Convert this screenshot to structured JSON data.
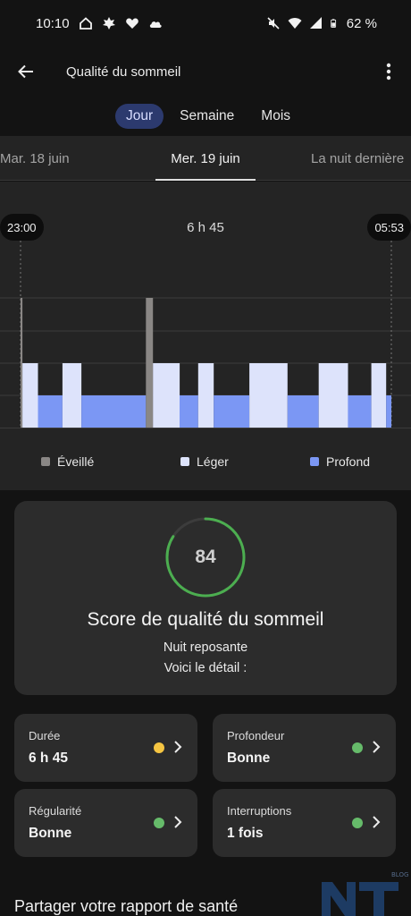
{
  "status_bar": {
    "time": "10:10",
    "left_icons": [
      "home-icon",
      "leaf-icon",
      "heart-icon",
      "cloud-icon"
    ],
    "right_icons": [
      "mute-icon",
      "wifi-icon",
      "signal-icon",
      "battery-icon"
    ],
    "battery": "62 %"
  },
  "app_bar": {
    "title": "Qualité du sommeil"
  },
  "period_tabs": [
    {
      "label": "Jour",
      "active": true
    },
    {
      "label": "Semaine",
      "active": false
    },
    {
      "label": "Mois",
      "active": false
    }
  ],
  "dates": {
    "prev": "Mar. 18 juin",
    "current": "Mer. 19 juin",
    "next": "La nuit dernière"
  },
  "chart_data": {
    "type": "hypnogram",
    "start_time": "23:00",
    "end_time": "05:53",
    "duration": "6 h 45",
    "legend": [
      {
        "label": "Éveillé",
        "color": "#8a8785"
      },
      {
        "label": "Léger",
        "color": "#dde3fb"
      },
      {
        "label": "Profond",
        "color": "#7b97f4"
      }
    ],
    "stages": [
      {
        "stage": "Éveillé",
        "start": 0.0,
        "end": 0.005
      },
      {
        "stage": "Léger",
        "start": 0.005,
        "end": 0.047
      },
      {
        "stage": "Profond",
        "start": 0.047,
        "end": 0.113
      },
      {
        "stage": "Léger",
        "start": 0.113,
        "end": 0.164
      },
      {
        "stage": "Profond",
        "start": 0.164,
        "end": 0.338
      },
      {
        "stage": "Éveillé",
        "start": 0.338,
        "end": 0.357
      },
      {
        "stage": "Léger",
        "start": 0.357,
        "end": 0.429
      },
      {
        "stage": "Profond",
        "start": 0.429,
        "end": 0.479
      },
      {
        "stage": "Léger",
        "start": 0.479,
        "end": 0.521
      },
      {
        "stage": "Profond",
        "start": 0.521,
        "end": 0.617
      },
      {
        "stage": "Léger",
        "start": 0.617,
        "end": 0.72
      },
      {
        "stage": "Profond",
        "start": 0.72,
        "end": 0.804
      },
      {
        "stage": "Léger",
        "start": 0.804,
        "end": 0.883
      },
      {
        "stage": "Profond",
        "start": 0.883,
        "end": 0.946
      },
      {
        "stage": "Léger",
        "start": 0.946,
        "end": 0.986
      },
      {
        "stage": "Profond",
        "start": 0.986,
        "end": 1.0
      }
    ]
  },
  "score": {
    "value": "84",
    "fraction": 0.84,
    "ring_color": "#4cae50",
    "title": "Score de qualité du sommeil",
    "subtitle": "Nuit reposante",
    "detail": "Voici le détail :"
  },
  "metrics": [
    {
      "label": "Durée",
      "value": "6 h 45",
      "status_color": "#f5c542"
    },
    {
      "label": "Profondeur",
      "value": "Bonne",
      "status_color": "#66bb6a"
    },
    {
      "label": "Régularité",
      "value": "Bonne",
      "status_color": "#66bb6a"
    },
    {
      "label": "Interruptions",
      "value": "1 fois",
      "status_color": "#66bb6a"
    }
  ],
  "share": {
    "title": "Partager votre rapport de santé"
  },
  "watermark": {
    "text": "NT",
    "sub": "BLOG"
  }
}
